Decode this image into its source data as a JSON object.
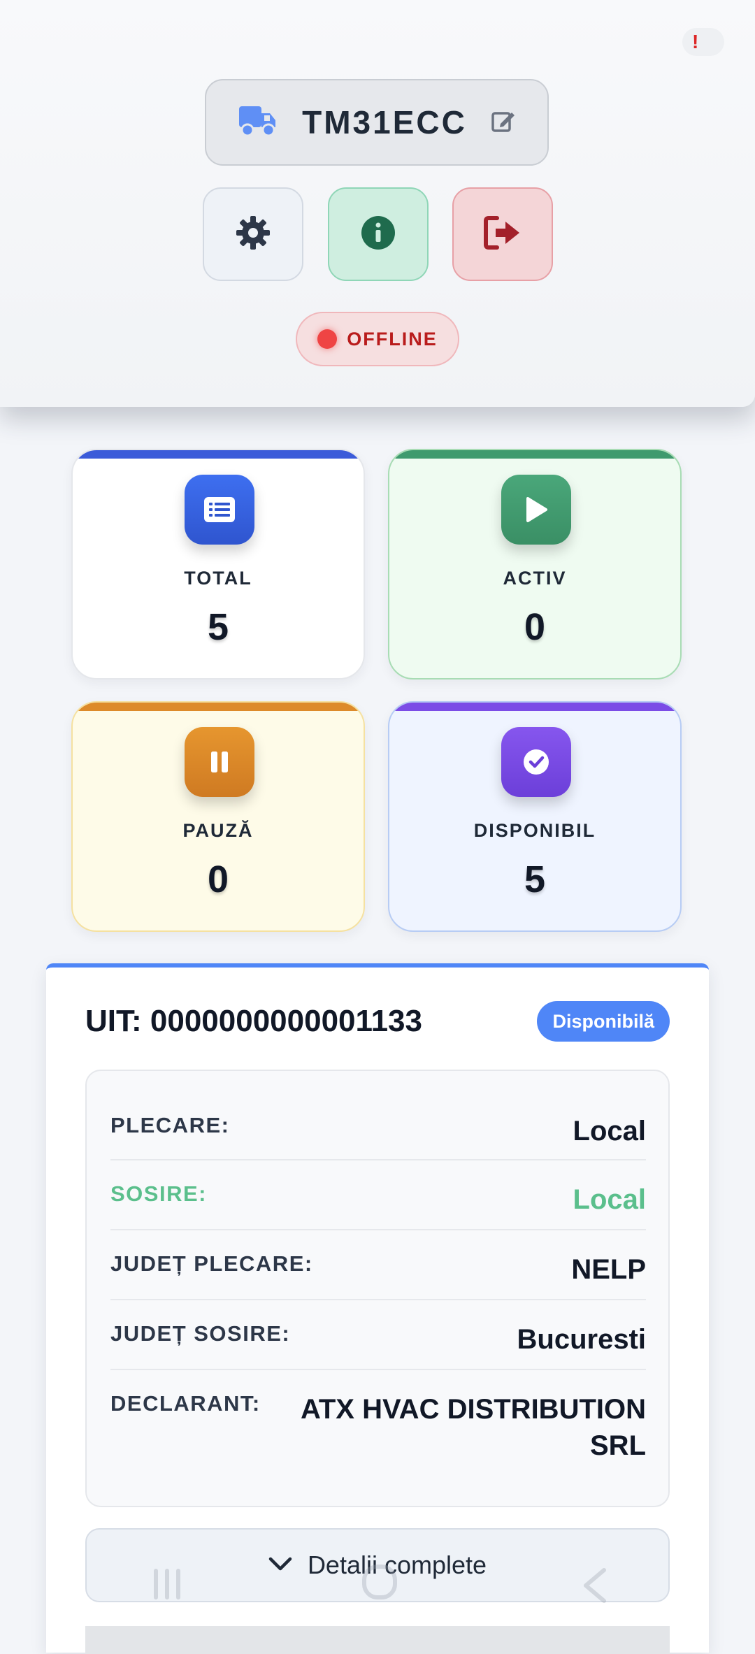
{
  "header": {
    "plate": "TM31ECC",
    "status": "OFFLINE",
    "icons": [
      "truck-icon",
      "edit-icon",
      "gear-icon",
      "info-icon",
      "logout-icon"
    ]
  },
  "stats": [
    {
      "label": "TOTAL",
      "value": "5",
      "color": "#3b5fe0",
      "icon": "list-icon"
    },
    {
      "label": "ACTIV",
      "value": "0",
      "color": "#3f9a6e",
      "icon": "play-icon"
    },
    {
      "label": "PAUZĂ",
      "value": "0",
      "color": "#dd8a2a",
      "icon": "pause-icon"
    },
    {
      "label": "DISPONIBIL",
      "value": "5",
      "color": "#7b4ce6",
      "icon": "check-badge-icon"
    }
  ],
  "uit": {
    "title": "UIT: 0000000000001133",
    "badge": "Disponibilă",
    "rows": [
      {
        "key": "PLECARE:",
        "value": "Local"
      },
      {
        "key": "SOSIRE:",
        "value": "Local"
      },
      {
        "key": "JUDEȚ PLECARE:",
        "value": "NELP"
      },
      {
        "key": "JUDEȚ SOSIRE:",
        "value": "Bucuresti"
      },
      {
        "key": "DECLARANT:",
        "value": "ATX HVAC DISTRIBUTION SRL"
      }
    ],
    "expand_label": "Detalii complete"
  },
  "colors": {
    "accent": "#4f86f7",
    "offline": "#ef4444",
    "sosire_green": "#5bbf8c"
  }
}
